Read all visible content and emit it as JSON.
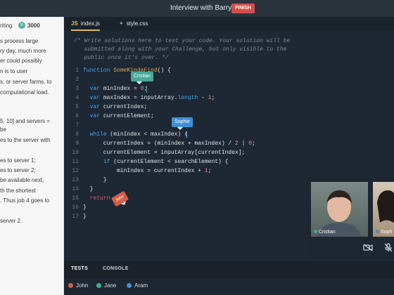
{
  "header": {
    "title": "Interview with Barry",
    "finish_label": "FINISH",
    "finish_color": "#d94b4b"
  },
  "problem": {
    "category": "riting",
    "points": "3000",
    "lines": [
      "s process large",
      "ry day, much more",
      "er could possibly",
      "n is to user",
      "s, or server farms, to",
      "computational load.",
      "",
      "5, 10] and servers =",
      "be",
      "es to the server with",
      "",
      "es to server 1;",
      "es to server 2;",
      "be available next,",
      "th the shortest",
      ". Thus job 4 goes to",
      "",
      "server 2."
    ]
  },
  "editor": {
    "tabs": [
      {
        "ext": "JS",
        "name": "index.js",
        "active": true
      },
      {
        "ext": "✦",
        "name": "style.css",
        "active": false
      }
    ],
    "comment": [
      "/* Write solutions here to test your code. Your solution will be",
      "   submitted along with your Challenge, but only visible to the",
      "   public once it's over. */"
    ],
    "line_numbers": [
      "1",
      "2",
      "3",
      "4",
      "5",
      "6",
      "7",
      "8",
      "9",
      "10",
      "11",
      "12",
      "13",
      "14",
      "15",
      "16",
      "17"
    ]
  },
  "cursors": [
    {
      "name": "Cristian",
      "color": "#49a89a"
    },
    {
      "name": "Sophie",
      "color": "#3f8fd6"
    },
    {
      "name": "John",
      "color": "#d45d4a"
    }
  ],
  "video": {
    "tiles": [
      {
        "name": "Cristian",
        "dot": "#49a89a"
      },
      {
        "name": "Soph",
        "dot": "#3f8fd6"
      }
    ],
    "icons": [
      "camera-off-icon",
      "mic-off-icon"
    ]
  },
  "bottom": {
    "tabs": [
      "TESTS",
      "CONSOLE"
    ],
    "participants": [
      {
        "name": "John",
        "color": "#d45d4a"
      },
      {
        "name": "Jane",
        "color": "#3db28a"
      },
      {
        "name": "Aram",
        "color": "#3f8fd6"
      }
    ]
  }
}
